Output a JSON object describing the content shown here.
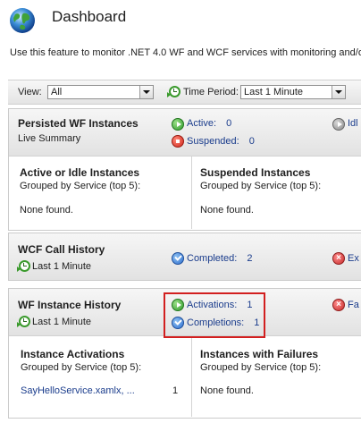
{
  "header": {
    "title": "Dashboard",
    "description": "Use this feature to monitor .NET 4.0 WF and WCF services with monitoring and/o"
  },
  "toolbar": {
    "view_label": "View:",
    "view_value": "All",
    "time_label": "Time Period:",
    "time_value": "Last 1 Minute"
  },
  "persisted": {
    "title": "Persisted WF Instances",
    "subtitle": "Live Summary",
    "active_label": "Active:",
    "active_count": "0",
    "suspended_label": "Suspended:",
    "suspended_count": "0",
    "idle_label": "Idl",
    "left": {
      "title": "Active or Idle Instances",
      "subtitle": "Grouped by Service (top 5):",
      "empty": "None found."
    },
    "right": {
      "title": "Suspended Instances",
      "subtitle": "Grouped by Service (top 5):",
      "empty": "None found."
    }
  },
  "wcf": {
    "title": "WCF Call History",
    "period": "Last 1 Minute",
    "completed_label": "Completed:",
    "completed_count": "2",
    "errors_label": "Ex"
  },
  "wfhistory": {
    "title": "WF Instance History",
    "period": "Last 1 Minute",
    "activations_label": "Activations:",
    "activations_count": "1",
    "completions_label": "Completions:",
    "completions_count": "1",
    "failures_label": "Fa",
    "left": {
      "title": "Instance Activations",
      "subtitle": "Grouped by Service (top 5):",
      "rows": [
        {
          "service": "SayHelloService.xamlx, ...",
          "count": "1"
        }
      ]
    },
    "right": {
      "title": "Instances with Failures",
      "subtitle": "Grouped by Service (top 5):",
      "empty": "None found."
    }
  },
  "colors": {
    "link": "#1a3c8c",
    "highlight": "#d21f1f"
  }
}
